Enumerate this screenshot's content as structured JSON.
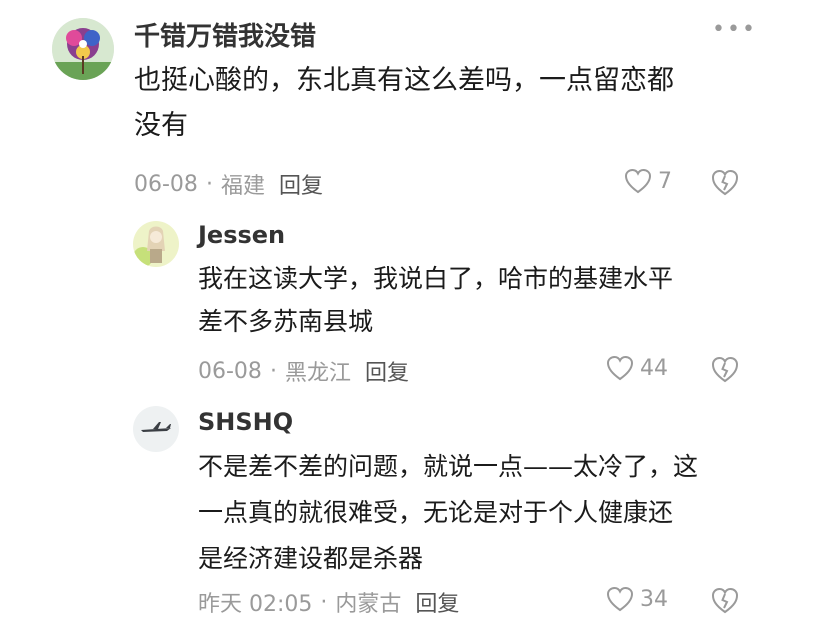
{
  "comments": [
    {
      "username": "千错万错我没错",
      "text_line1": "也挺心酸的，东北真有这么差吗，一点留恋都",
      "text_line2": "没有",
      "date": "06-08",
      "location": "福建",
      "reply_label": "回复",
      "likes": "7",
      "more_label": "•••"
    },
    {
      "username": "Jessen",
      "text_line1": "我在这读大学，我说白了，哈市的基建水平",
      "text_line2": "差不多苏南县城",
      "date": "06-08",
      "location": "黑龙江",
      "reply_label": "回复",
      "likes": "44"
    },
    {
      "username": "SHSHQ",
      "text_line1": "不是差不差的问题，就说一点——太冷了，这",
      "text_line2": "一点真的就很难受，无论是对于个人健康还",
      "text_line3": "是经济建设都是杀器",
      "date": "昨天 02:05",
      "location": "内蒙古",
      "reply_label": "回复",
      "likes": "34"
    }
  ],
  "meta_separator": "·",
  "colors": {
    "meta_gray": "#9a9a9a",
    "text": "#1b1b1b",
    "username": "#333333"
  },
  "icons": [
    "heart-outline-icon",
    "broken-heart-icon",
    "more-dots-icon"
  ]
}
